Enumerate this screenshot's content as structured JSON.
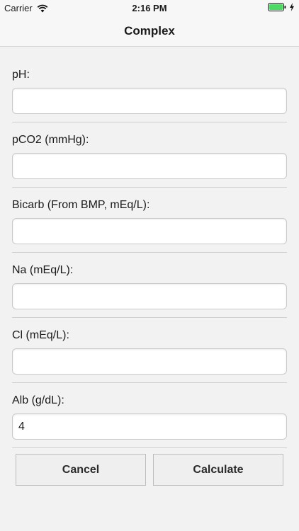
{
  "status_bar": {
    "carrier": "Carrier",
    "time": "2:16 PM",
    "icons": [
      "wifi-icon",
      "battery-icon",
      "charging-bolt-icon"
    ],
    "battery_color": "#4cd964"
  },
  "nav": {
    "title": "Complex"
  },
  "fields": [
    {
      "label": "pH:",
      "value": ""
    },
    {
      "label": "pCO2 (mmHg):",
      "value": ""
    },
    {
      "label": "Bicarb (From BMP, mEq/L):",
      "value": ""
    },
    {
      "label": "Na (mEq/L):",
      "value": ""
    },
    {
      "label": "Cl (mEq/L):",
      "value": ""
    },
    {
      "label": "Alb (g/dL):",
      "value": "4"
    }
  ],
  "buttons": {
    "cancel": "Cancel",
    "calculate": "Calculate"
  }
}
